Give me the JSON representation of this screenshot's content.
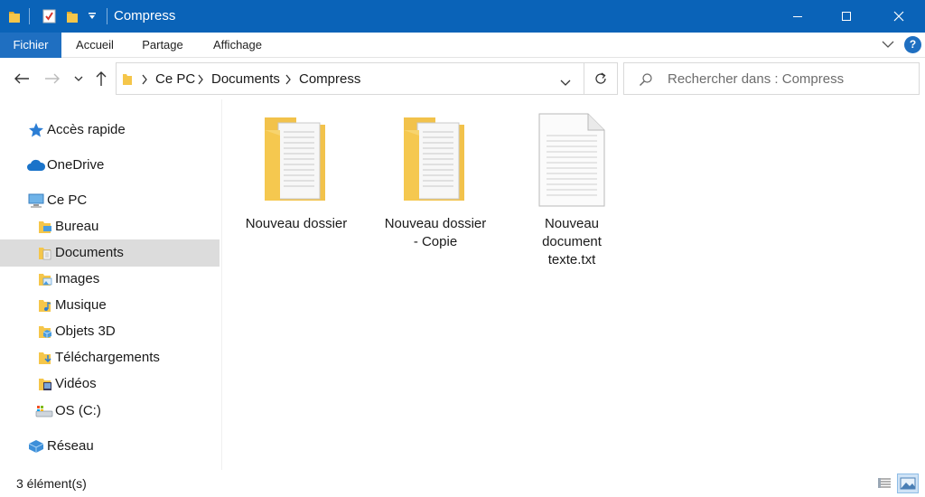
{
  "window": {
    "title": "Compress",
    "accent": "#0a63b8"
  },
  "ribbon": {
    "tabs": [
      "Fichier",
      "Accueil",
      "Partage",
      "Affichage"
    ],
    "help_label": "?"
  },
  "address": {
    "crumbs": [
      "Ce PC",
      "Documents",
      "Compress"
    ]
  },
  "search": {
    "placeholder": "Rechercher dans : Compress"
  },
  "sidebar": {
    "items": [
      {
        "label": "Accès rapide",
        "icon": "star-icon"
      },
      {
        "label": "OneDrive",
        "icon": "cloud-icon"
      },
      {
        "label": "Ce PC",
        "icon": "computer-icon"
      },
      {
        "label": "Bureau",
        "icon": "desktop-folder-icon"
      },
      {
        "label": "Documents",
        "icon": "documents-folder-icon",
        "selected": true
      },
      {
        "label": "Images",
        "icon": "images-folder-icon"
      },
      {
        "label": "Musique",
        "icon": "music-folder-icon"
      },
      {
        "label": "Objets 3D",
        "icon": "objects-3d-folder-icon"
      },
      {
        "label": "Téléchargements",
        "icon": "downloads-folder-icon"
      },
      {
        "label": "Vidéos",
        "icon": "videos-folder-icon"
      },
      {
        "label": "OS (C:)",
        "icon": "drive-icon"
      },
      {
        "label": "Réseau",
        "icon": "network-icon"
      }
    ]
  },
  "files": [
    {
      "label_lines": [
        "Nouveau dossier"
      ],
      "type": "folder"
    },
    {
      "label_lines": [
        "Nouveau dossier",
        "- Copie"
      ],
      "type": "folder"
    },
    {
      "label_lines": [
        "Nouveau",
        "document",
        "texte.txt"
      ],
      "type": "text-file"
    }
  ],
  "status": {
    "count_text": "3 élément(s)"
  }
}
